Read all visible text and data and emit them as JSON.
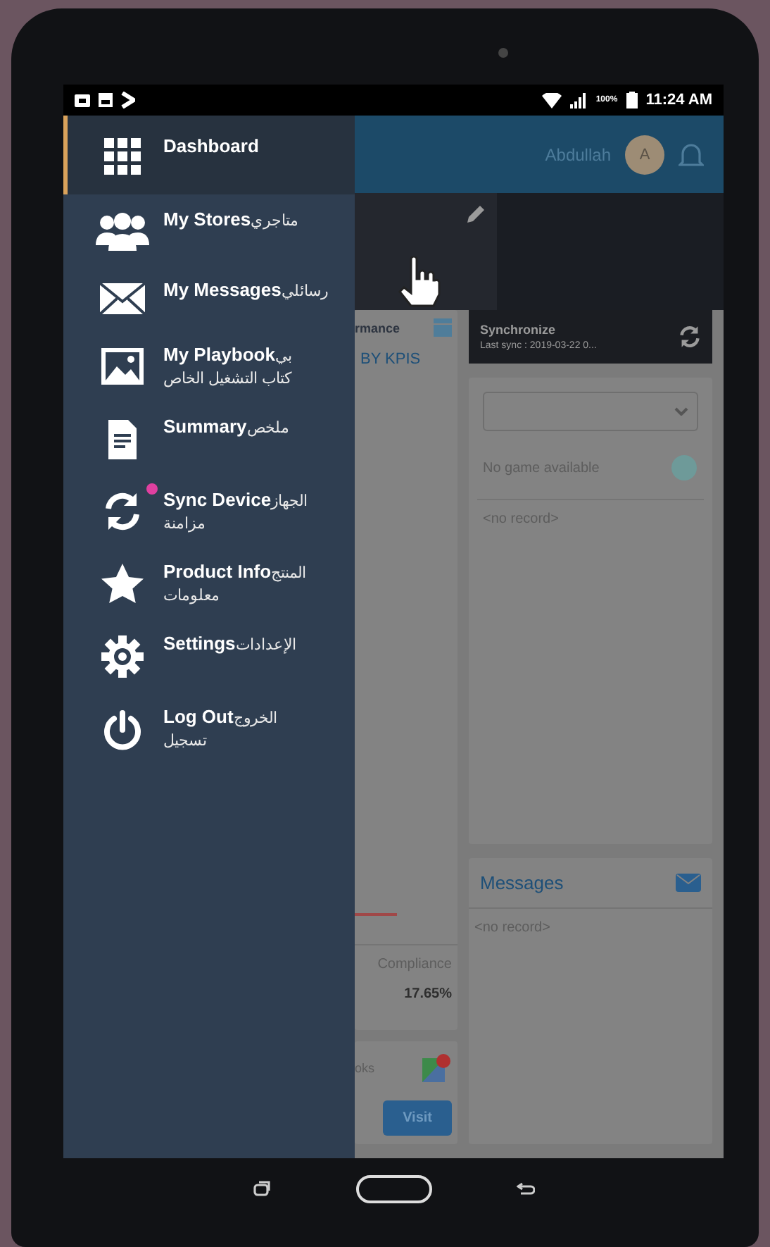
{
  "status_bar": {
    "battery_text": "100%",
    "time": "11:24 AM"
  },
  "top_bar": {
    "user_name": "Abdullah",
    "avatar_initial": "A"
  },
  "drawer": {
    "items": [
      {
        "label": "Dashboard",
        "selected": true,
        "badge": false
      },
      {
        "label": "My Stores",
        "arabic": [
          "متاجري"
        ],
        "selected": false,
        "badge": false
      },
      {
        "label": "My Messages",
        "arabic": [
          "رسائلي"
        ],
        "selected": false,
        "badge": false
      },
      {
        "label": "My Playbook",
        "arabic": [
          "بي",
          "كتاب التشغيل الخاص"
        ],
        "selected": false,
        "badge": false
      },
      {
        "label": "Summary",
        "arabic": [
          "ملخص"
        ],
        "selected": false,
        "badge": false
      },
      {
        "label": "Sync Device",
        "arabic": [
          "الجهاز",
          "مزامنة"
        ],
        "selected": false,
        "badge": true
      },
      {
        "label": "Product Info",
        "arabic": [
          "المنتج",
          "معلومات"
        ],
        "selected": false,
        "badge": false
      },
      {
        "label": "Settings",
        "arabic": [
          "الإعدادات"
        ],
        "selected": false,
        "badge": false
      },
      {
        "label": "Log Out",
        "arabic": [
          "الخروج",
          "تسجيل"
        ],
        "selected": false,
        "badge": false
      }
    ]
  },
  "left_column": {
    "card_title": "rmance",
    "kpi_link": "BY KPIS",
    "compliance_label": "Compliance",
    "compliance_value": "17.65%",
    "tasks_label": "oks",
    "visit_button": "Visit"
  },
  "sync_card": {
    "title": "Synchronize",
    "last_sync": "Last sync : 2019-03-22 0..."
  },
  "game_card": {
    "empty_text": "No game available",
    "records_text": "<no record>"
  },
  "messages_card": {
    "title": "Messages",
    "records_text": "<no record>"
  }
}
